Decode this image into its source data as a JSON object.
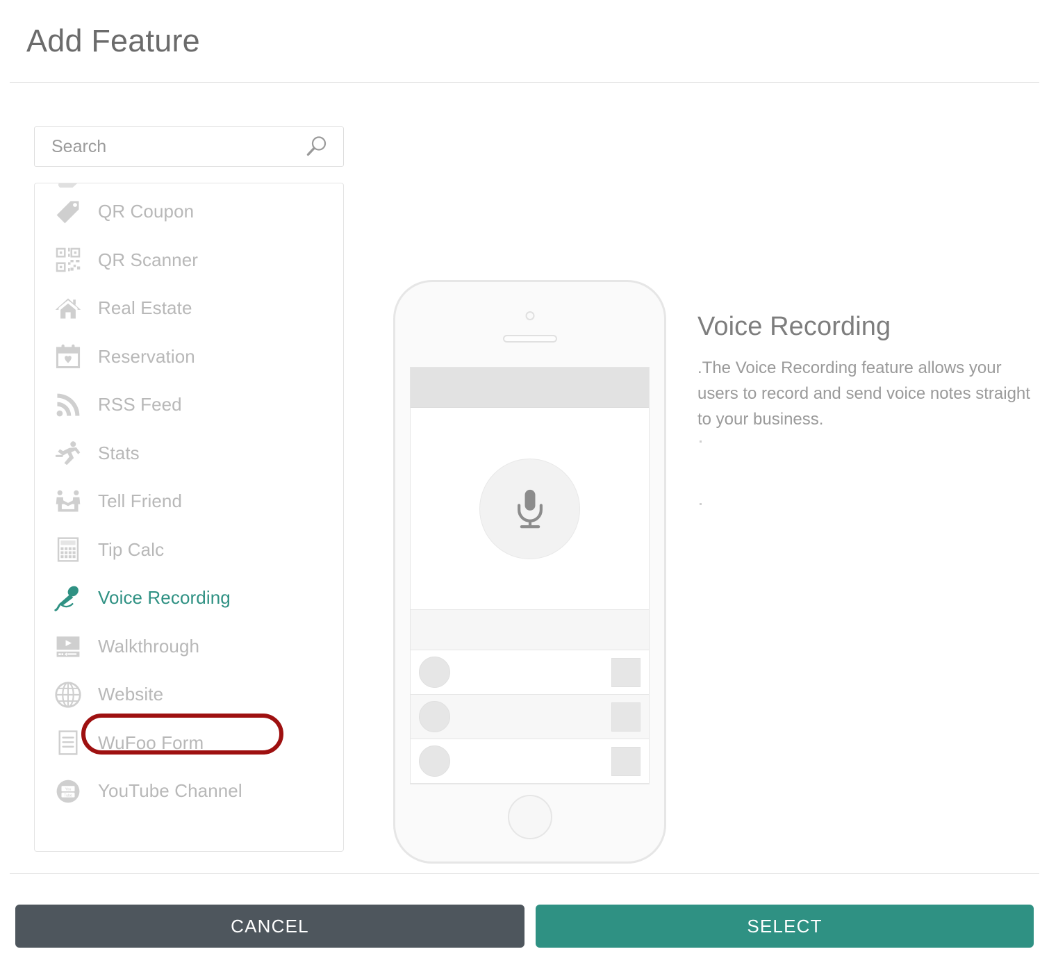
{
  "header": {
    "title": "Add Feature"
  },
  "search": {
    "placeholder": "Search",
    "value": "",
    "icon": "search-icon"
  },
  "feature_list": {
    "items": [
      {
        "label": "QR Coupon",
        "icon": "tag-icon",
        "selected": false
      },
      {
        "label": "QR Scanner",
        "icon": "qr-code-icon",
        "selected": false
      },
      {
        "label": "Real Estate",
        "icon": "house-icon",
        "selected": false
      },
      {
        "label": "Reservation",
        "icon": "calendar-heart-icon",
        "selected": false
      },
      {
        "label": "RSS Feed",
        "icon": "rss-icon",
        "selected": false
      },
      {
        "label": "Stats",
        "icon": "runner-icon",
        "selected": false
      },
      {
        "label": "Tell Friend",
        "icon": "two-people-icon",
        "selected": false
      },
      {
        "label": "Tip Calc",
        "icon": "calculator-icon",
        "selected": false
      },
      {
        "label": "Voice Recording",
        "icon": "microphone-icon",
        "selected": true
      },
      {
        "label": "Walkthrough",
        "icon": "video-player-icon",
        "selected": false
      },
      {
        "label": "Website",
        "icon": "globe-icon",
        "selected": false
      },
      {
        "label": "WuFoo Form",
        "icon": "form-document-icon",
        "selected": false
      },
      {
        "label": "YouTube Channel",
        "icon": "youtube-icon",
        "selected": false
      }
    ]
  },
  "preview": {
    "device": "phone-mockup",
    "screen_icon": "microphone-icon",
    "rows": 3
  },
  "info": {
    "title": "Voice Recording",
    "description": ".The Voice Recording feature allows your users to record and send voice notes straight to your business."
  },
  "footer": {
    "cancel_label": "CANCEL",
    "select_label": "SELECT"
  },
  "colors": {
    "accent_teal": "#2f9183",
    "cancel_gray": "#4e565d",
    "annotation_red": "#9e1010",
    "muted_text": "#b8b8b8",
    "title_text": "#6b6b6b"
  }
}
